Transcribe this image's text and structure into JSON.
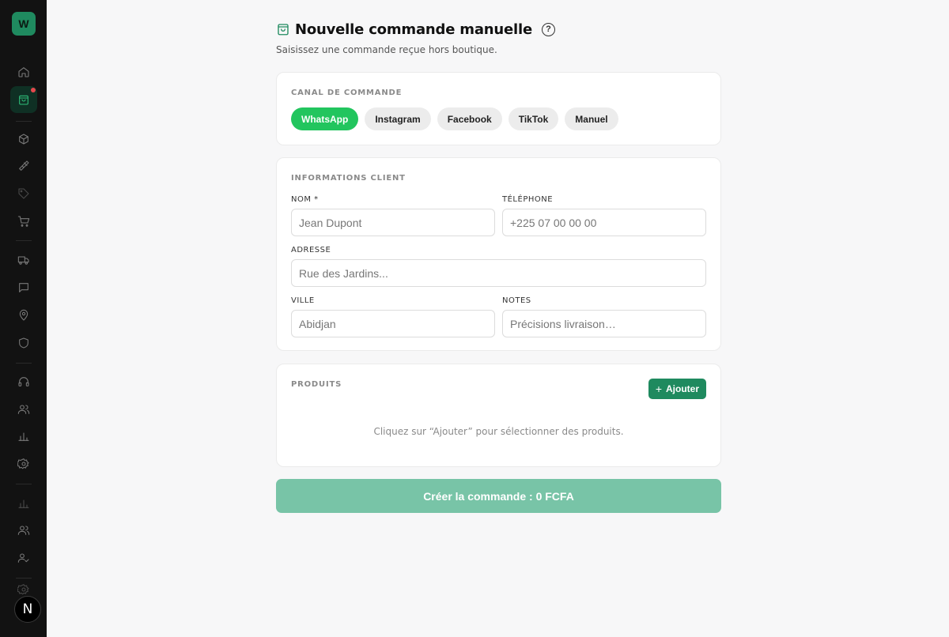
{
  "sidebar": {
    "logo_letter": "W",
    "avatar_letter": "N",
    "items": [
      {
        "name": "home-icon"
      },
      {
        "name": "shopping-bag-icon",
        "active": true,
        "notification": true
      },
      {
        "name": "box-icon"
      },
      {
        "name": "brush-icon"
      },
      {
        "name": "tag-icon"
      },
      {
        "name": "cart-icon"
      },
      {
        "name": "truck-icon"
      },
      {
        "name": "message-icon"
      },
      {
        "name": "map-pin-icon"
      },
      {
        "name": "shield-icon"
      },
      {
        "name": "headphones-icon"
      },
      {
        "name": "users-icon"
      },
      {
        "name": "bar-chart-icon"
      },
      {
        "name": "settings-icon"
      },
      {
        "name": "bar-chart-icon"
      },
      {
        "name": "users-icon"
      },
      {
        "name": "user-check-icon"
      },
      {
        "name": "settings-icon"
      }
    ]
  },
  "header": {
    "title": "Nouvelle commande manuelle",
    "help": "?",
    "subtitle": "Saisissez une commande reçue hors boutique."
  },
  "channel": {
    "label": "CANAL DE COMMANDE",
    "options": [
      "WhatsApp",
      "Instagram",
      "Facebook",
      "TikTok",
      "Manuel"
    ],
    "selected": "WhatsApp"
  },
  "client": {
    "label": "INFORMATIONS CLIENT",
    "name_label": "NOM *",
    "name_placeholder": "Jean Dupont",
    "phone_label": "TÉLÉPHONE",
    "phone_placeholder": "+225 07 00 00 00",
    "address_label": "ADRESSE",
    "address_placeholder": "Rue des Jardins...",
    "city_label": "VILLE",
    "city_placeholder": "Abidjan",
    "notes_label": "NOTES",
    "notes_placeholder": "Précisions livraison…"
  },
  "products": {
    "label": "PRODUITS",
    "add_label": "Ajouter",
    "empty_hint": "Cliquez sur “Ajouter” pour sélectionner des produits."
  },
  "submit_label": "Créer la commande : 0 FCFA",
  "colors": {
    "accent": "#1f8a5f",
    "chip_active": "#22c55e",
    "submit_disabled": "#78c4a7",
    "sidebar_bg": "#121212"
  }
}
